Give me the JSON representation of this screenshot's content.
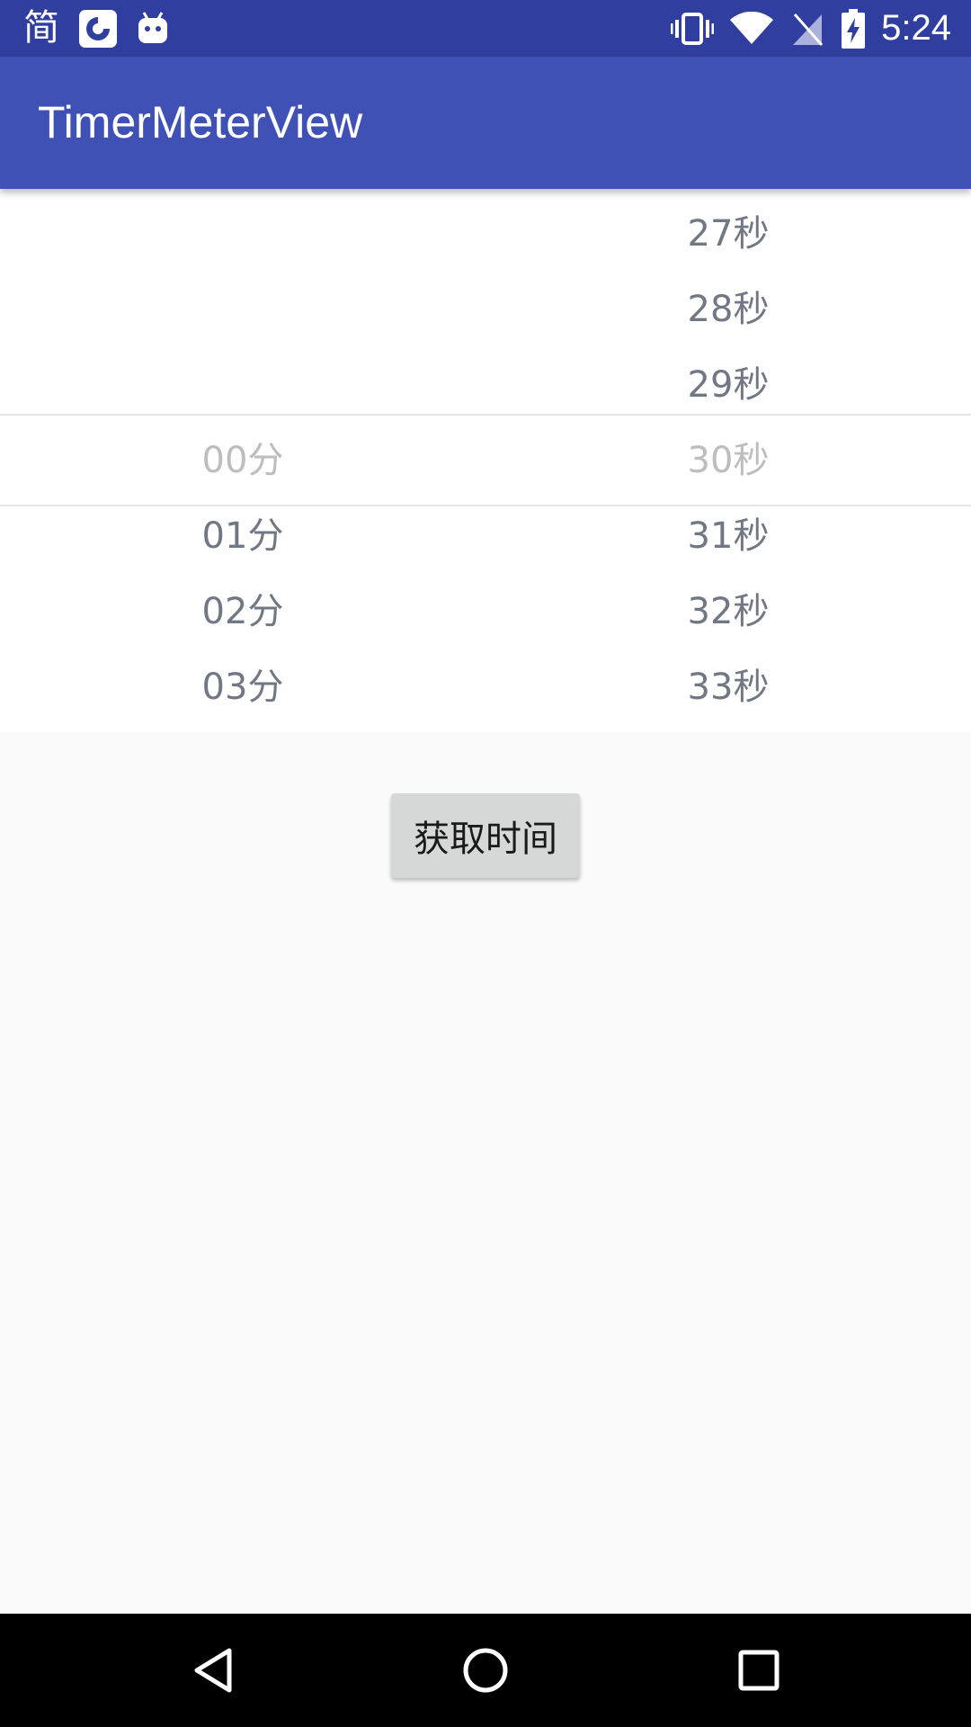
{
  "status_bar": {
    "left_icons": [
      {
        "name": "simplified-chinese-icon",
        "text": "简"
      },
      {
        "name": "app-notification-icon"
      },
      {
        "name": "android-debug-icon"
      }
    ],
    "right_icons": [
      "vibrate-icon",
      "wifi-icon",
      "no-sim-icon",
      "battery-charging-icon"
    ],
    "time": "5:24"
  },
  "app_bar": {
    "title": "TimerMeterView"
  },
  "picker": {
    "minutes": {
      "items_above": [],
      "selected": "00分",
      "items_below": [
        "01分",
        "02分",
        "03分"
      ]
    },
    "seconds": {
      "items_above": [
        "27秒",
        "28秒",
        "29秒"
      ],
      "selected": "30秒",
      "items_below": [
        "31秒",
        "32秒",
        "33秒"
      ]
    }
  },
  "button": {
    "label": "获取时间"
  },
  "nav_bar": {
    "buttons": [
      "back-icon",
      "home-icon",
      "recents-icon"
    ]
  },
  "colors": {
    "status_bar": "#303f9f",
    "app_bar": "#3f51b5",
    "picker_text": "#717783",
    "picker_selected_text": "#bdbdbd",
    "button_bg": "#d6d7d7"
  }
}
